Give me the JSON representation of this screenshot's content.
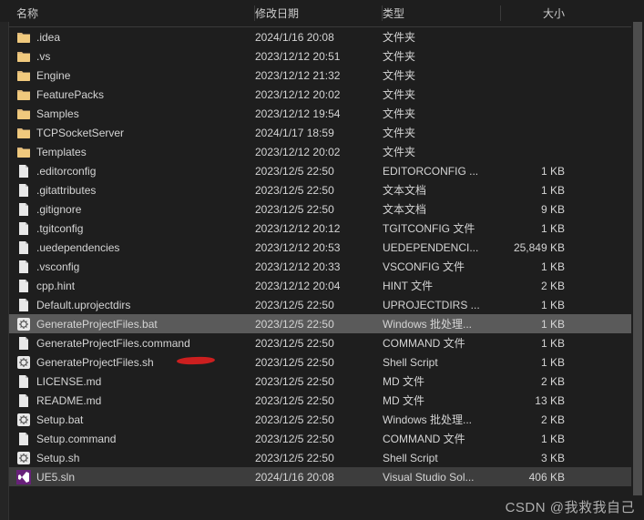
{
  "columns": {
    "name": "名称",
    "date": "修改日期",
    "type": "类型",
    "size": "大小"
  },
  "files": [
    {
      "name": ".idea",
      "date": "2024/1/16 20:08",
      "type": "文件夹",
      "size": "",
      "icon": "folder"
    },
    {
      "name": ".vs",
      "date": "2023/12/12 20:51",
      "type": "文件夹",
      "size": "",
      "icon": "folder"
    },
    {
      "name": "Engine",
      "date": "2023/12/12 21:32",
      "type": "文件夹",
      "size": "",
      "icon": "folder"
    },
    {
      "name": "FeaturePacks",
      "date": "2023/12/12 20:02",
      "type": "文件夹",
      "size": "",
      "icon": "folder"
    },
    {
      "name": "Samples",
      "date": "2023/12/12 19:54",
      "type": "文件夹",
      "size": "",
      "icon": "folder"
    },
    {
      "name": "TCPSocketServer",
      "date": "2024/1/17 18:59",
      "type": "文件夹",
      "size": "",
      "icon": "folder"
    },
    {
      "name": "Templates",
      "date": "2023/12/12 20:02",
      "type": "文件夹",
      "size": "",
      "icon": "folder"
    },
    {
      "name": ".editorconfig",
      "date": "2023/12/5 22:50",
      "type": "EDITORCONFIG ...",
      "size": "1 KB",
      "icon": "file"
    },
    {
      "name": ".gitattributes",
      "date": "2023/12/5 22:50",
      "type": "文本文档",
      "size": "1 KB",
      "icon": "file"
    },
    {
      "name": ".gitignore",
      "date": "2023/12/5 22:50",
      "type": "文本文档",
      "size": "9 KB",
      "icon": "file"
    },
    {
      "name": ".tgitconfig",
      "date": "2023/12/12 20:12",
      "type": "TGITCONFIG 文件",
      "size": "1 KB",
      "icon": "file"
    },
    {
      "name": ".uedependencies",
      "date": "2023/12/12 20:53",
      "type": "UEDEPENDENCI...",
      "size": "25,849 KB",
      "icon": "file"
    },
    {
      "name": ".vsconfig",
      "date": "2023/12/12 20:33",
      "type": "VSCONFIG 文件",
      "size": "1 KB",
      "icon": "file"
    },
    {
      "name": "cpp.hint",
      "date": "2023/12/12 20:04",
      "type": "HINT 文件",
      "size": "2 KB",
      "icon": "file"
    },
    {
      "name": "Default.uprojectdirs",
      "date": "2023/12/5 22:50",
      "type": "UPROJECTDIRS ...",
      "size": "1 KB",
      "icon": "file"
    },
    {
      "name": "GenerateProjectFiles.bat",
      "date": "2023/12/5 22:50",
      "type": "Windows 批处理...",
      "size": "1 KB",
      "icon": "gear",
      "selected": true
    },
    {
      "name": "GenerateProjectFiles.command",
      "date": "2023/12/5 22:50",
      "type": "COMMAND 文件",
      "size": "1 KB",
      "icon": "file"
    },
    {
      "name": "GenerateProjectFiles.sh",
      "date": "2023/12/5 22:50",
      "type": "Shell Script",
      "size": "1 KB",
      "icon": "gear"
    },
    {
      "name": "LICENSE.md",
      "date": "2023/12/5 22:50",
      "type": "MD 文件",
      "size": "2 KB",
      "icon": "file"
    },
    {
      "name": "README.md",
      "date": "2023/12/5 22:50",
      "type": "MD 文件",
      "size": "13 KB",
      "icon": "file"
    },
    {
      "name": "Setup.bat",
      "date": "2023/12/5 22:50",
      "type": "Windows 批处理...",
      "size": "2 KB",
      "icon": "gear"
    },
    {
      "name": "Setup.command",
      "date": "2023/12/5 22:50",
      "type": "COMMAND 文件",
      "size": "1 KB",
      "icon": "file"
    },
    {
      "name": "Setup.sh",
      "date": "2023/12/5 22:50",
      "type": "Shell Script",
      "size": "3 KB",
      "icon": "gear"
    },
    {
      "name": "UE5.sln",
      "date": "2024/1/16 20:08",
      "type": "Visual Studio Sol...",
      "size": "406 KB",
      "icon": "vs",
      "highlighted": true
    }
  ],
  "watermark": "CSDN @我救我自己"
}
